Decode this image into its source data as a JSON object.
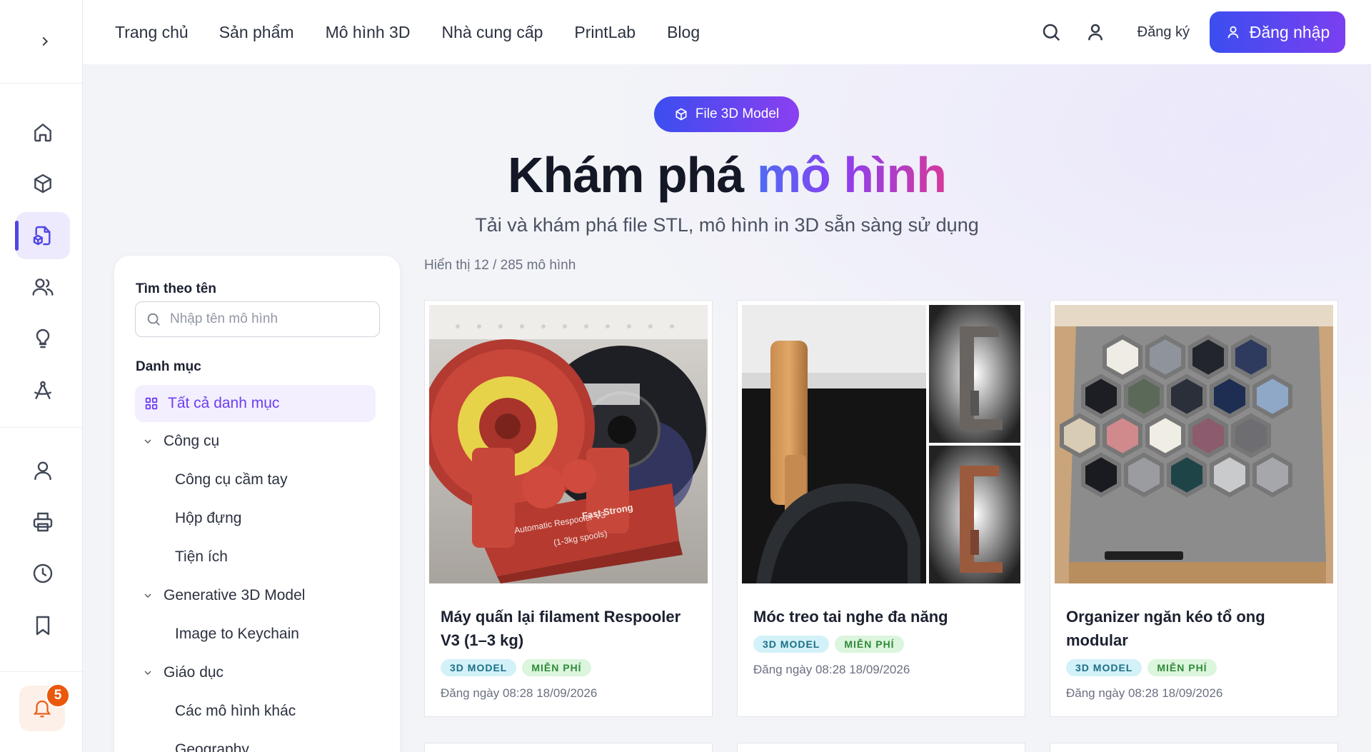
{
  "nav": {
    "items": [
      "Trang chủ",
      "Sản phẩm",
      "Mô hình 3D",
      "Nhà cung cấp",
      "PrintLab",
      "Blog"
    ],
    "register_label": "Đăng ký",
    "login_label": "Đăng nhập"
  },
  "rail": {
    "icons": [
      "home-icon",
      "cube-icon",
      "model-file-icon",
      "users-icon",
      "lightbulb-icon",
      "compass-icon",
      "user-icon",
      "printer-icon",
      "clock-icon",
      "bookmark-icon"
    ],
    "active_index": 2,
    "notification_count": "5"
  },
  "hero": {
    "badge": "File 3D Model",
    "title_plain": "Khám phá ",
    "title_accent": "mô hình",
    "subtitle": "Tải và khám phá file STL, mô hình in 3D sẵn sàng sử dụng"
  },
  "filter": {
    "search_label": "Tìm theo tên",
    "search_placeholder": "Nhập tên mô hình",
    "category_label": "Danh mục",
    "all_categories": "Tất cả danh mục",
    "groups": [
      {
        "name": "Công cụ",
        "children": [
          "Công cụ cầm tay",
          "Hộp đựng",
          "Tiện ích"
        ]
      },
      {
        "name": "Generative 3D Model",
        "children": [
          "Image to Keychain"
        ]
      },
      {
        "name": "Giáo dục",
        "children": [
          "Các mô hình khác",
          "Geography"
        ]
      }
    ]
  },
  "results": {
    "count_text": "Hiển thị 12 / 285 mô hình",
    "cards": [
      {
        "title": "Máy quấn lại filament Respooler V3 (1–3 kg)",
        "tags": [
          "3D MODEL",
          "MIỄN PHÍ"
        ],
        "date": "Đăng ngày 08:28 18/09/2026",
        "spool_text": "Fast Strong Automatic Respooler V3 (1-3kg spools)"
      },
      {
        "title": "Móc treo tai nghe đa năng",
        "tags": [
          "3D MODEL",
          "MIỄN PHÍ"
        ],
        "date": "Đăng ngày 08:28 18/09/2026"
      },
      {
        "title": "Organizer ngăn kéo tổ ong modular",
        "tags": [
          "3D MODEL",
          "MIỄN PHÍ"
        ],
        "date": "Đăng ngày 08:28 18/09/2026"
      }
    ]
  },
  "colors": {
    "accent": "#4f46e5",
    "gradient_start": "#3b4ef0",
    "gradient_end": "#8b3ff0",
    "notification": "#ea580c"
  }
}
